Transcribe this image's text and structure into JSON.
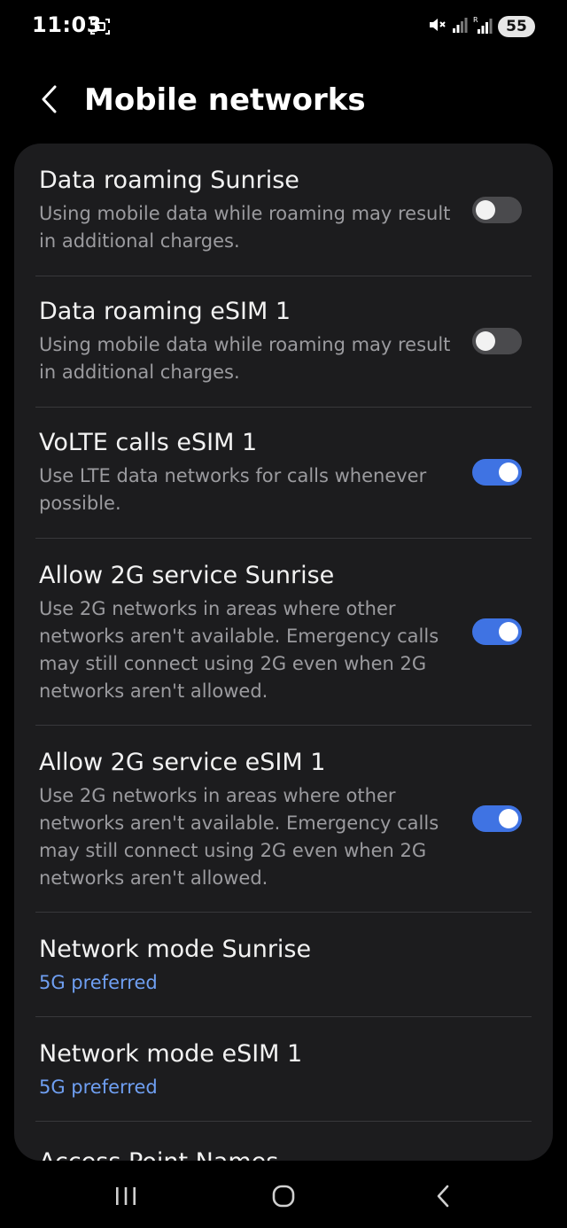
{
  "status_bar": {
    "time": "11:03",
    "battery": "55"
  },
  "header": {
    "title": "Mobile networks"
  },
  "settings": [
    {
      "title": "Data roaming Sunrise",
      "description": "Using mobile data while roaming may result in additional charges.",
      "toggle": false
    },
    {
      "title": "Data roaming eSIM 1",
      "description": "Using mobile data while roaming may result in additional charges.",
      "toggle": false
    },
    {
      "title": "VoLTE calls eSIM 1",
      "description": "Use LTE data networks for calls whenever possible.",
      "toggle": true
    },
    {
      "title": "Allow 2G service Sunrise",
      "description": "Use 2G networks in areas where other networks aren't available. Emergency calls may still connect using 2G even when 2G networks aren't allowed.",
      "toggle": true
    },
    {
      "title": "Allow 2G service eSIM 1",
      "description": "Use 2G networks in areas where other networks aren't available. Emergency calls may still connect using 2G even when 2G networks aren't allowed.",
      "toggle": true
    },
    {
      "title": "Network mode Sunrise",
      "value": "5G preferred"
    },
    {
      "title": "Network mode eSIM 1",
      "value": "5G preferred"
    },
    {
      "title": "Access Point Names"
    }
  ],
  "colors": {
    "accent": "#3f73e3",
    "value_text": "#6f9ff2",
    "card_background": "#1c1c1e"
  },
  "icons": {
    "back": "chevron-left-icon",
    "mute": "mute-icon",
    "signal": "signal-icon",
    "screenshot": "screenshot-icon",
    "recent_apps": "recent-apps-icon",
    "home": "home-icon",
    "nav_back": "back-icon"
  }
}
